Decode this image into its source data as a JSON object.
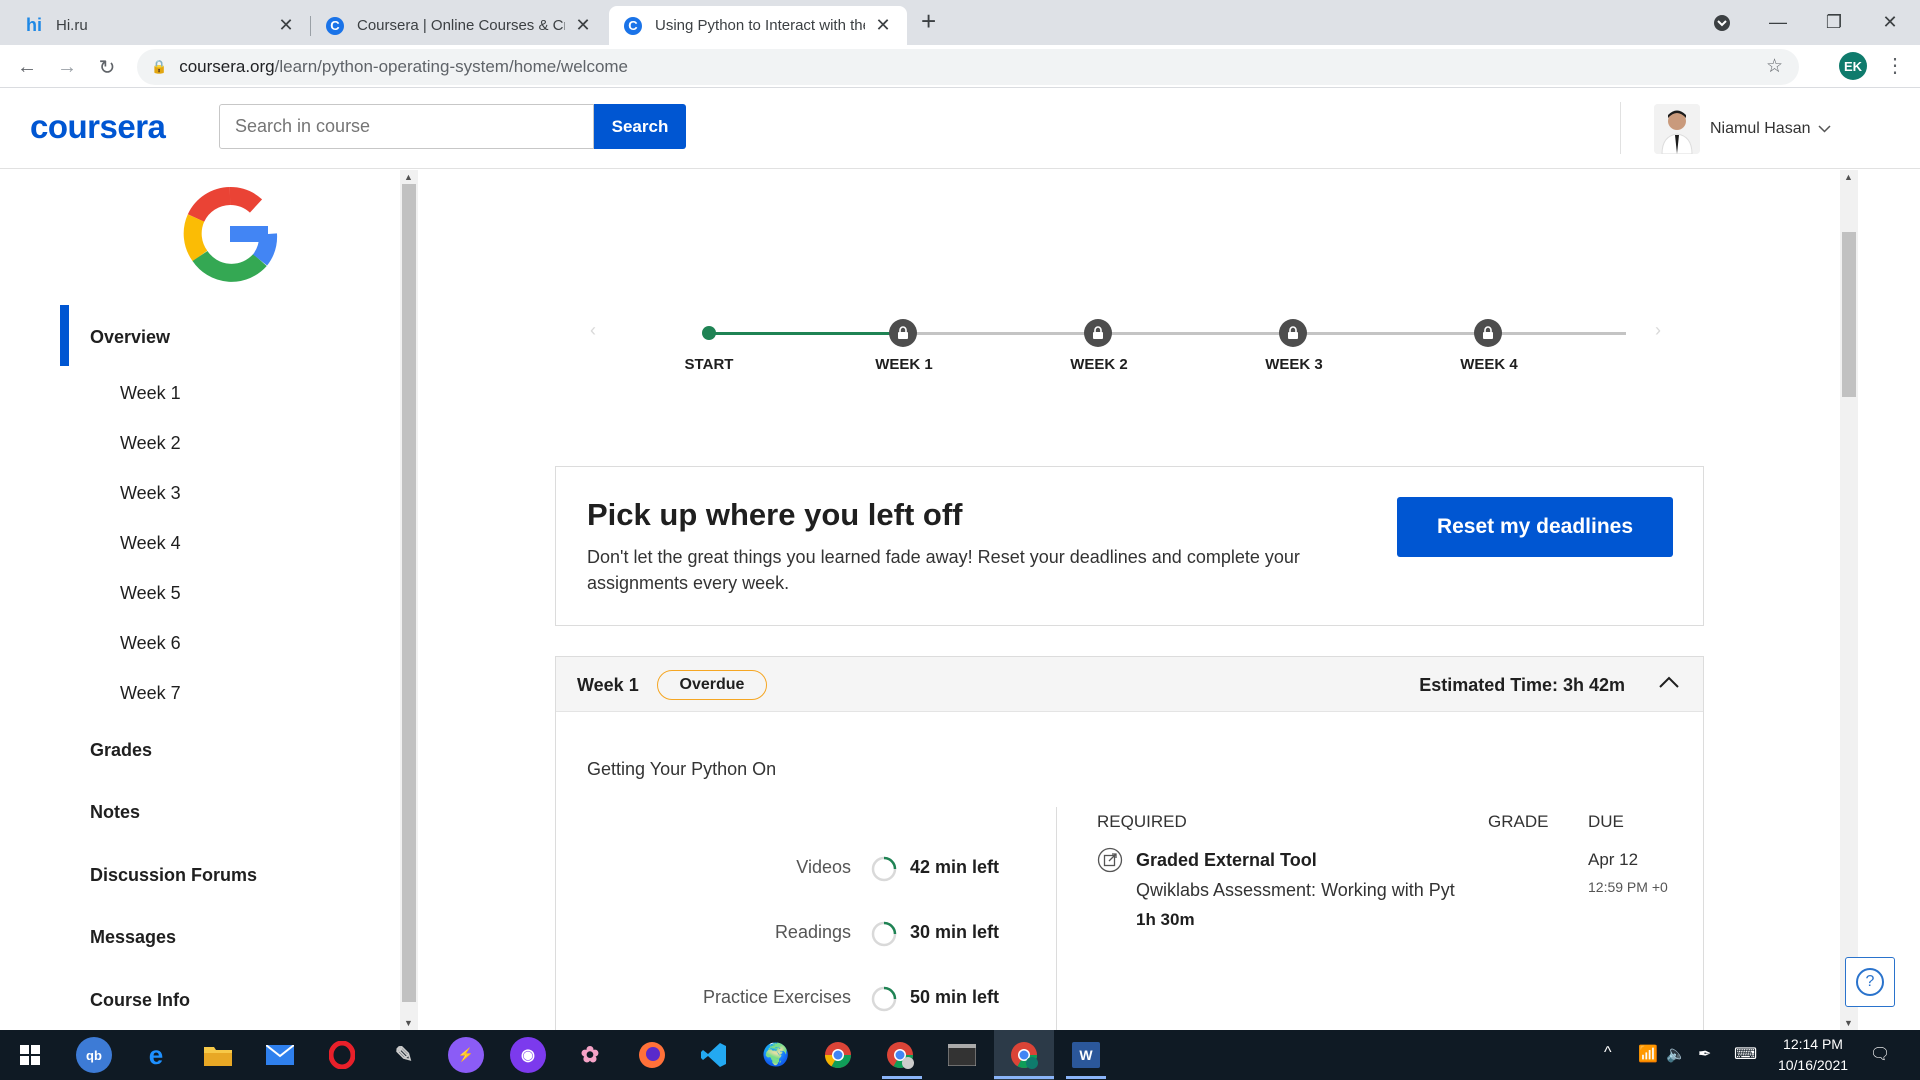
{
  "browser": {
    "tabs": [
      {
        "title": "Hi.ru",
        "favicon": "hi-icon"
      },
      {
        "title": "Coursera | Online Courses & Crec",
        "favicon": "coursera-icon"
      },
      {
        "title": "Using Python to Interact with the",
        "favicon": "coursera-icon",
        "active": true
      }
    ],
    "url_host": "coursera.org",
    "url_path": "/learn/python-operating-system/home/welcome",
    "profile_initials": "EK"
  },
  "header": {
    "logo": "coursera",
    "search_placeholder": "Search in course",
    "search_button": "Search",
    "user_name": "Niamul Hasan"
  },
  "sidebar": {
    "items": [
      {
        "label": "Overview",
        "active": true
      },
      {
        "label": "Week 1"
      },
      {
        "label": "Week 2"
      },
      {
        "label": "Week 3"
      },
      {
        "label": "Week 4"
      },
      {
        "label": "Week 5"
      },
      {
        "label": "Week 6"
      },
      {
        "label": "Week 7"
      },
      {
        "label": "Grades"
      },
      {
        "label": "Notes"
      },
      {
        "label": "Discussion Forums"
      },
      {
        "label": "Messages"
      },
      {
        "label": "Course Info"
      }
    ]
  },
  "timeline": {
    "labels": [
      "START",
      "WEEK 1",
      "WEEK 2",
      "WEEK 3",
      "WEEK 4"
    ],
    "accent": "#1f8354"
  },
  "banner": {
    "title": "Pick up where you left off",
    "text": "Don't let the great things you learned fade away! Reset your deadlines and complete your assignments every week.",
    "button": "Reset my deadlines"
  },
  "week": {
    "title": "Week 1",
    "badge": "Overdue",
    "estimated": "Estimated Time: 3h 42m",
    "lesson": "Getting Your Python On",
    "stats": [
      {
        "label": "Videos",
        "value": "42 min left"
      },
      {
        "label": "Readings",
        "value": "30 min left"
      },
      {
        "label": "Practice Exercises",
        "value": "50 min left"
      }
    ],
    "table_headers": {
      "required": "REQUIRED",
      "grade": "GRADE",
      "due": "DUE"
    },
    "assignment": {
      "type": "Graded External Tool",
      "name": "Qwiklabs Assessment: Working with Pyt",
      "duration": "1h 30m",
      "due_date": "Apr 12",
      "due_time": "12:59 PM +0"
    }
  },
  "help": "?",
  "taskbar": {
    "time": "12:14 PM",
    "date": "10/16/2021"
  },
  "colors": {
    "brand": "#0056d2",
    "badge_border": "#f5a623",
    "progress_green": "#1f8354"
  }
}
